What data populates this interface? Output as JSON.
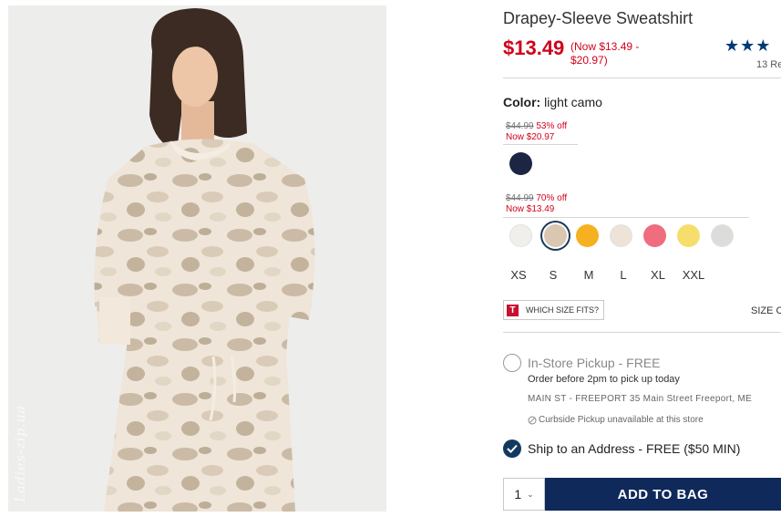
{
  "product": {
    "title": "Drapey-Sleeve Sweatshirt",
    "price": "$13.49",
    "price_range": "(Now $13.49 - $20.97)",
    "rating_stars": "★★★",
    "rating_value": 3,
    "reviews_label": "13 Re"
  },
  "color": {
    "label": "Color:",
    "value": "light camo"
  },
  "offers": [
    {
      "original": "$44.99",
      "discount": "53% off",
      "now": "Now $20.97"
    },
    {
      "original": "$44.99",
      "discount": "70% off",
      "now": "Now $13.49"
    }
  ],
  "swatches": {
    "group1": [
      {
        "name": "navy",
        "color": "#1c2542"
      }
    ],
    "group2": [
      {
        "name": "white",
        "color": "#f0efec"
      },
      {
        "name": "light camo",
        "color": "#d9c7b2",
        "selected": true
      },
      {
        "name": "yellow",
        "color": "#f6b121"
      },
      {
        "name": "cream",
        "color": "#ede3d6"
      },
      {
        "name": "pink",
        "color": "#ef6d7e"
      },
      {
        "name": "light yellow",
        "color": "#f6de6c"
      },
      {
        "name": "light gray",
        "color": "#dcdcda"
      }
    ]
  },
  "sizes": [
    "XS",
    "S",
    "M",
    "L",
    "XL",
    "XXL"
  ],
  "fit": {
    "logo": "T",
    "label": "WHICH SIZE FITS?",
    "size_chart": "SIZE C"
  },
  "fulfillment": {
    "pickup_title": "In-Store Pickup - FREE",
    "pickup_sub": "Order before 2pm to pick up today",
    "store": "MAIN ST - FREEPORT 35 Main Street Freeport, ME",
    "curbside": "Curbside Pickup unavailable at this store",
    "ship_title": "Ship to an Address - FREE ($50 MIN)"
  },
  "cart": {
    "quantity": "1",
    "add_label": "ADD TO BAG"
  },
  "photo": {
    "watermark": "Ladies-zip.ua"
  },
  "colors": {
    "price_red": "#d0021b",
    "navy_button": "#0f2a5a",
    "star_blue": "#003a78"
  }
}
